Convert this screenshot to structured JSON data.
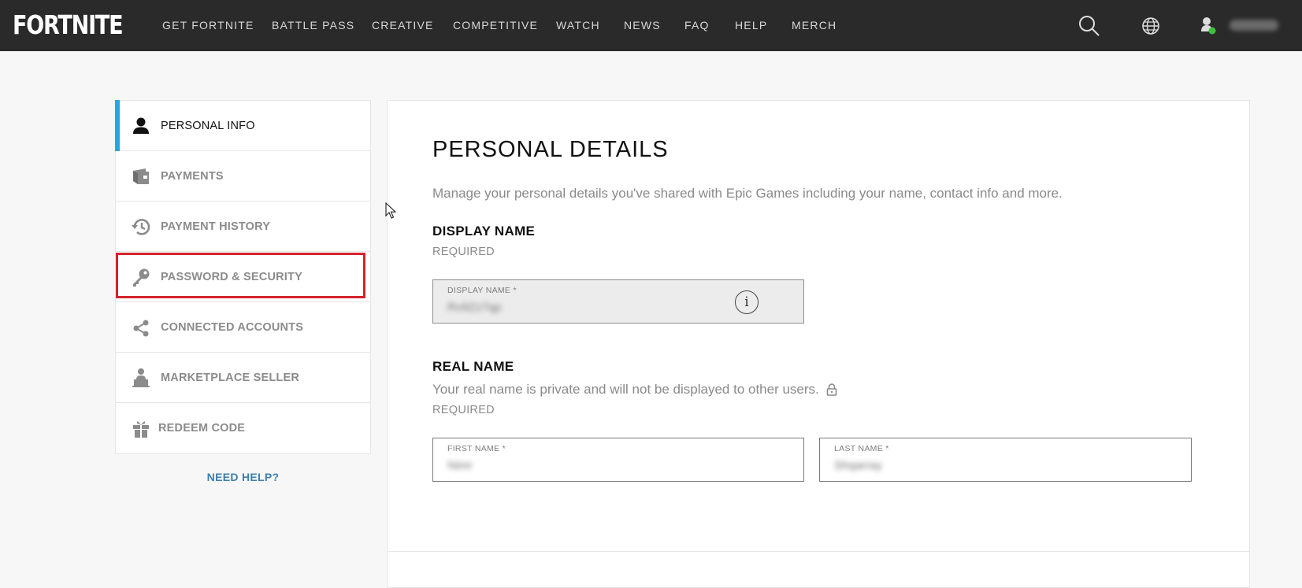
{
  "brand": {
    "logo_text": "FORTNITE"
  },
  "nav": {
    "items": [
      "GET FORTNITE",
      "BATTLE PASS",
      "CREATIVE",
      "COMPETITIVE",
      "WATCH",
      "NEWS",
      "FAQ",
      "HELP",
      "MERCH"
    ],
    "icons": [
      "search-icon",
      "globe-icon",
      "user-status-icon"
    ],
    "status_color": "#3fbd3f"
  },
  "sidebar": {
    "accent_color": "#24a7e0",
    "items": [
      {
        "label": "PERSONAL INFO",
        "icon": "person-icon",
        "active": true
      },
      {
        "label": "PAYMENTS",
        "icon": "wallet-icon"
      },
      {
        "label": "PAYMENT HISTORY",
        "icon": "history-icon"
      },
      {
        "label": "PASSWORD & SECURITY",
        "icon": "key-icon",
        "highlighted": true
      },
      {
        "label": "CONNECTED ACCOUNTS",
        "icon": "share-icon"
      },
      {
        "label": "MARKETPLACE SELLER",
        "icon": "seller-icon"
      },
      {
        "label": "REDEEM CODE",
        "icon": "gift-icon"
      }
    ],
    "help_link": "NEED HELP?",
    "highlight_color": "#d3242b"
  },
  "main": {
    "title": "PERSONAL DETAILS",
    "description": "Manage your personal details you've shared with Epic Games including your name, contact info and more.",
    "display_name": {
      "heading": "DISPLAY NAME",
      "required": "REQUIRED",
      "field_label": "DISPLAY NAME *",
      "value": "Rv9Zz7qp"
    },
    "real_name": {
      "heading": "REAL NAME",
      "note": "Your real name is private and will not be displayed to other users.",
      "required": "REQUIRED",
      "first_label": "FIRST NAME *",
      "first_value": "Nimr",
      "last_label": "LAST NAME *",
      "last_value": "Shqarray"
    }
  }
}
